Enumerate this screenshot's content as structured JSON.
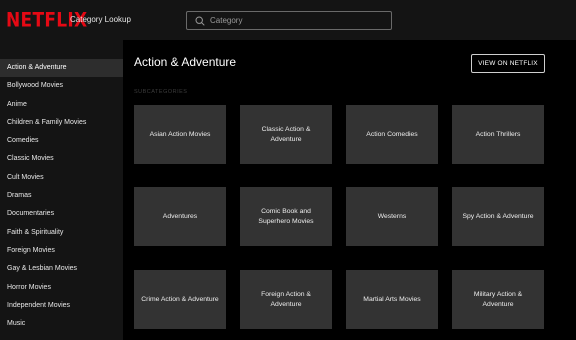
{
  "header": {
    "logo": "NETFLIX",
    "app_title": "Category Lookup",
    "search_placeholder": "Category"
  },
  "sidebar": {
    "items": [
      {
        "label": "Action & Adventure",
        "active": true
      },
      {
        "label": "Bollywood Movies"
      },
      {
        "label": "Anime"
      },
      {
        "label": "Children & Family Movies"
      },
      {
        "label": "Comedies"
      },
      {
        "label": "Classic Movies"
      },
      {
        "label": "Cult Movies"
      },
      {
        "label": "Dramas"
      },
      {
        "label": "Documentaries"
      },
      {
        "label": "Faith & Spirituality"
      },
      {
        "label": "Foreign Movies"
      },
      {
        "label": "Gay & Lesbian Movies"
      },
      {
        "label": "Horror Movies"
      },
      {
        "label": "Independent Movies"
      },
      {
        "label": "Music"
      }
    ]
  },
  "main": {
    "title": "Action & Adventure",
    "view_button": "VIEW ON NETFLIX",
    "subcategories_label": "SUBCATEGORIES",
    "tiles": [
      "Asian Action Movies",
      "Classic Action & Adventure",
      "Action Comedies",
      "Action Thrillers",
      "Adventures",
      "Comic Book and Superhero Movies",
      "Westerns",
      "Spy Action & Adventure",
      "Crime Action & Adventure",
      "Foreign Action & Adventure",
      "Martial Arts Movies",
      "Military Action & Adventure"
    ]
  },
  "colors": {
    "brand": "#e50914",
    "background": "#141414",
    "content_background": "#000000",
    "tile": "#333333",
    "active_item": "#2d2d2d"
  }
}
